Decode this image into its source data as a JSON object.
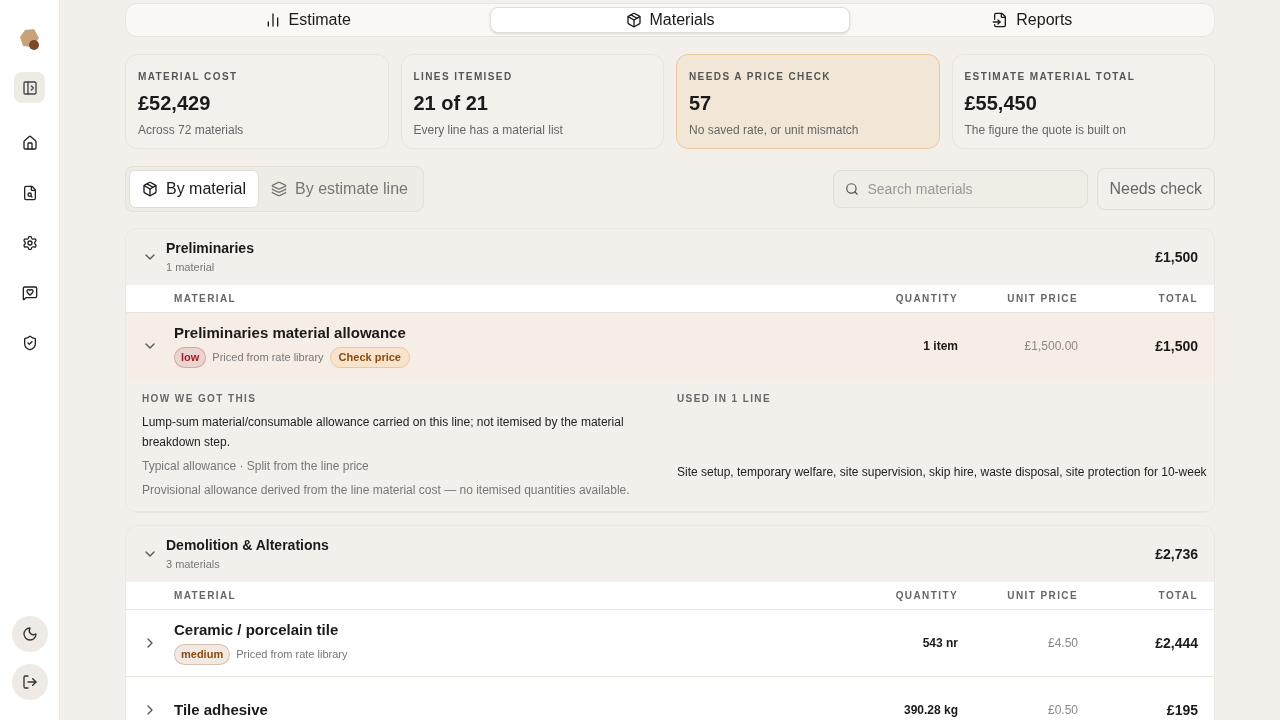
{
  "tabs": [
    {
      "label": "Estimate",
      "selected": false
    },
    {
      "label": "Materials",
      "selected": true
    },
    {
      "label": "Reports",
      "selected": false
    }
  ],
  "stats": [
    {
      "label": "MATERIAL COST",
      "value": "£52,429",
      "note": "Across 72 materials",
      "highlight": false
    },
    {
      "label": "LINES ITEMISED",
      "value": "21 of 21",
      "note": "Every line has a material list",
      "highlight": false
    },
    {
      "label": "NEEDS A PRICE CHECK",
      "value": "57",
      "note": "No saved rate, or unit mismatch",
      "highlight": true
    },
    {
      "label": "ESTIMATE MATERIAL TOTAL",
      "value": "£55,450",
      "note": "The figure the quote is built on",
      "highlight": false
    }
  ],
  "views": [
    {
      "label": "By material",
      "selected": true
    },
    {
      "label": "By estimate line",
      "selected": false
    }
  ],
  "search": {
    "placeholder": "Search materials"
  },
  "filter_button": "Needs check",
  "groups": [
    {
      "name": "Preliminaries",
      "count": "1 material",
      "total": "£1,500",
      "expanded": true,
      "columns": [
        "MATERIAL",
        "QUANTITY",
        "UNIT PRICE",
        "TOTAL"
      ],
      "materials": [
        {
          "name": "Preliminaries material allowance",
          "expanded": true,
          "badge": {
            "label": "low",
            "color": "#9f1d2c"
          },
          "source": "Priced from rate library",
          "flag": "Check price",
          "quantity": "1 item",
          "unit_price": "£1,500.00",
          "total": "£1,500",
          "detail": {
            "heading": "HOW WE GOT THIS",
            "text": "Lump-sum material/consumable allowance carried on this line; not itemised by the material breakdown step.",
            "basis": "Typical allowance · Split from the line price",
            "note": "Provisional allowance derived from the line material cost — no itemised quantities available.",
            "used_heading": "USED IN 1 LINE",
            "used": "Site setup, temporary welfare, site supervision, skip hire, waste disposal, site protection for 10-week"
          }
        }
      ]
    },
    {
      "name": "Demolition & Alterations",
      "count": "3 materials",
      "total": "£2,736",
      "expanded": true,
      "columns": [
        "MATERIAL",
        "QUANTITY",
        "UNIT PRICE",
        "TOTAL"
      ],
      "materials": [
        {
          "name": "Ceramic / porcelain tile",
          "expanded": false,
          "badge": {
            "label": "medium",
            "color": "#8a4a12"
          },
          "source": "Priced from rate library",
          "quantity": "543 nr",
          "unit_price": "£4.50",
          "total": "£2,444"
        },
        {
          "name": "Tile adhesive",
          "expanded": false,
          "quantity": "390.28 kg",
          "unit_price": "£0.50",
          "total": "£195"
        }
      ]
    }
  ]
}
